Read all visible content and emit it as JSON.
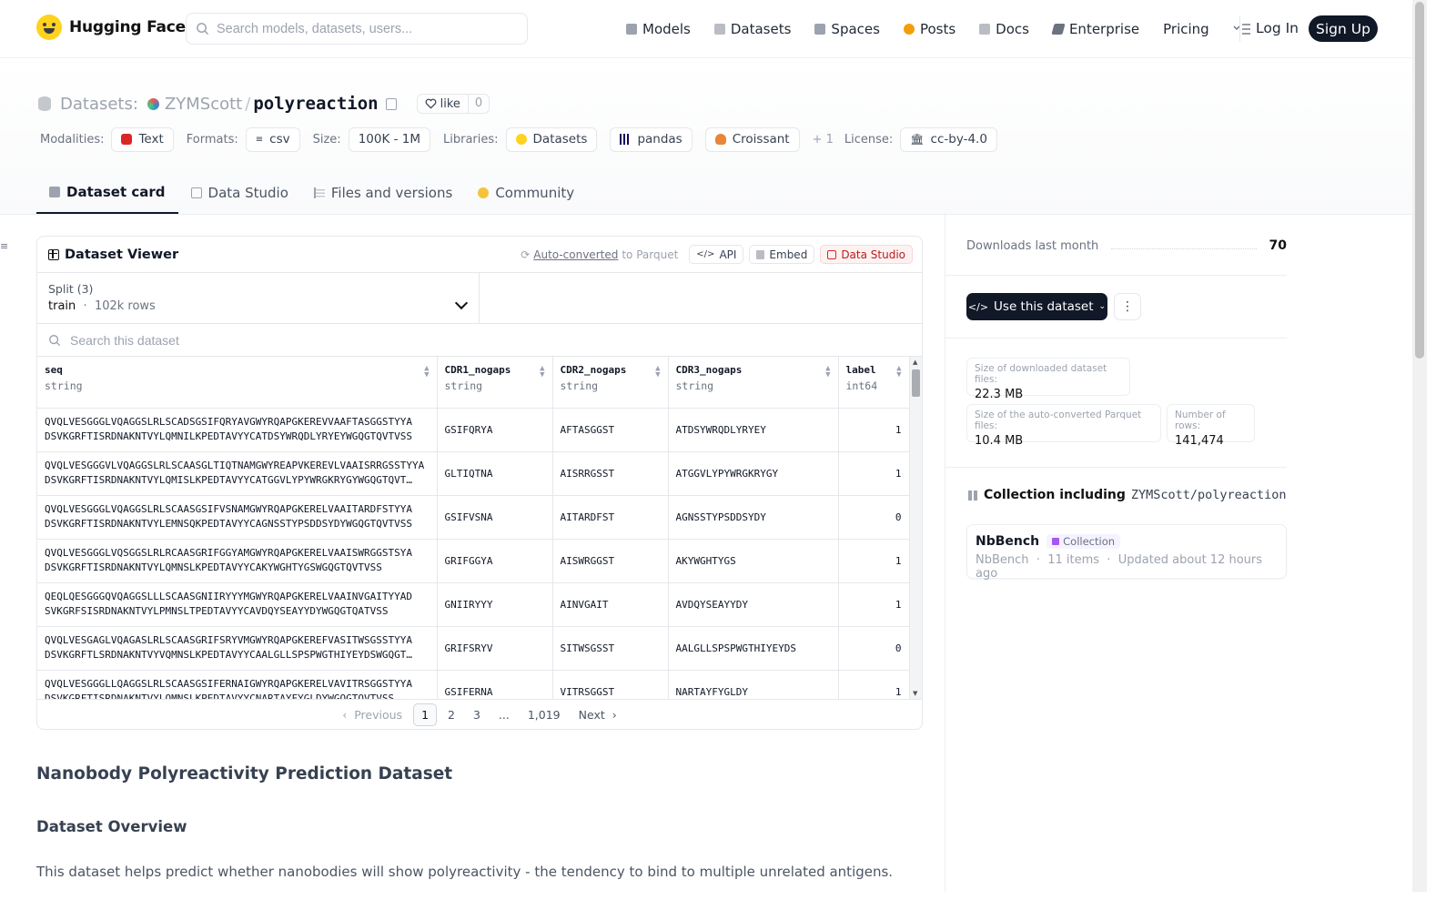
{
  "nav": {
    "brand": "Hugging Face",
    "search_placeholder": "Search models, datasets, users...",
    "links": [
      {
        "label": "Models",
        "color": "#9ca3af"
      },
      {
        "label": "Datasets",
        "color": "#b9bdc3"
      },
      {
        "label": "Spaces",
        "color": "#9ca3af"
      },
      {
        "label": "Posts",
        "color": "#f59e0b"
      },
      {
        "label": "Docs",
        "color": "#b9bdc3"
      },
      {
        "label": "Enterprise",
        "color": "#6b7280"
      },
      {
        "label": "Pricing",
        "color": ""
      }
    ],
    "login": "Log In",
    "signup": "Sign Up"
  },
  "repo": {
    "section": "Datasets:",
    "owner": "ZYMScott",
    "slash": "/",
    "name": "polyreaction",
    "like_label": "like",
    "like_count": "0"
  },
  "meta": {
    "modalities_label": "Modalities:",
    "modalities": "Text",
    "formats_label": "Formats:",
    "formats": "csv",
    "size_label": "Size:",
    "size": "100K - 1M",
    "libraries_label": "Libraries:",
    "libraries": [
      "Datasets",
      "pandas",
      "Croissant"
    ],
    "libraries_more": "+ 1",
    "license_label": "License:",
    "license": "cc-by-4.0"
  },
  "tabs": [
    "Dataset card",
    "Data Studio",
    "Files and versions",
    "Community"
  ],
  "viewer": {
    "title": "Dataset Viewer",
    "auto_converted": "Auto-converted",
    "to_parquet": "to Parquet",
    "api": "API",
    "embed": "Embed",
    "data_studio": "Data Studio",
    "split_label": "Split (3)",
    "split_name": "train",
    "split_rows": "102k rows",
    "search_placeholder": "Search this dataset",
    "columns": [
      {
        "name": "seq",
        "type": "string"
      },
      {
        "name": "CDR1_nogaps",
        "type": "string"
      },
      {
        "name": "CDR2_nogaps",
        "type": "string"
      },
      {
        "name": "CDR3_nogaps",
        "type": "string"
      },
      {
        "name": "label",
        "type": "int64"
      }
    ],
    "rows": [
      {
        "seq1": "QVQLVESGGGLVQAGGSLRLSCADSGSIFQRYAVGWYRQAPGKEREVVAAFTASGGSTYYA",
        "seq2": "DSVKGRFTISRDNAKNTVYLQMNILKPEDTAVYYCATDSYWRQDLYRYEYWGQGTQVTVSS",
        "cdr1": "GSIFQRYA",
        "cdr2": "AFTASGGST",
        "cdr3": "ATDSYWRQDLYRYEY",
        "label": "1"
      },
      {
        "seq1": "QVQLVESGGGVLVQAGGSLRLSCAASGLTIQTNAMGWYREAPVKEREVLVAAISRRGSSTYYA",
        "seq2": "DSVKGRFTISRDNAKNTVYLQMISLKPEDTAVYYCATGGVLYPYWRGKRYGYWGQGTQVT…",
        "cdr1": "GLTIQTNA",
        "cdr2": "AISRRGSST",
        "cdr3": "ATGGVLYPYWRGKRYGY",
        "label": "1"
      },
      {
        "seq1": "QVQLVESGGGLVQAGGSLRLSCAASGSIFVSNAMGWYRQAPGKERELVAAITARDFSTYYA",
        "seq2": "DSVKGRFTISRDNAKNTVYLEMNSQKPEDTAVYYCAGNSSTYPSDDSYDYWGQGTQVTVSS",
        "cdr1": "GSIFVSNA",
        "cdr2": "AITARDFST",
        "cdr3": "AGNSSTYPSDDSYDY",
        "label": "0"
      },
      {
        "seq1": "QVQLVESGGGLVQSGGSLRLRCAASGRIFGGYAMGWYRQAPGKERELVAAISWRGGSTSYA",
        "seq2": "DSVKGRFTISRDNAKNTVYLQMNSLKPEDTAVYYCAKYWGHTYGSWGQGTQVTVSS",
        "cdr1": "GRIFGGYA",
        "cdr2": "AISWRGGST",
        "cdr3": "AKYWGHTYGS",
        "label": "1"
      },
      {
        "seq1": "QEQLQESGGGQVQAGGSLLLSCAASGNIIRYYYMGWYRQAPGKERELVAAINVGAITYYAD",
        "seq2": "SVKGRFSISRDNAKNTVYLPMNSLTPEDTAVYYCAVDQYSEAYYDYWGQGTQATVSS",
        "cdr1": "GNIIRYYY",
        "cdr2": "AINVGAIT",
        "cdr3": "AVDQYSEAYYDY",
        "label": "1"
      },
      {
        "seq1": "QVQLVESGAGLVQAGASLRLSCAASGRIFSRYVMGWYRQAPGKEREFVASITWSGSSTYYA",
        "seq2": "DSVKGRFTLSRDNAKNTVYVQMNSLKPEDTAVYYCAALGLLSPSPWGTHIYEYDSWGQGT…",
        "cdr1": "GRIFSRYV",
        "cdr2": "SITWSGSST",
        "cdr3": "AALGLLSPSPWGTHIYEYDS",
        "label": "0"
      },
      {
        "seq1": "QVQLVESGGGLLQAGGSLRLSCAASGSIFERNAIGWYRQAPGKERELVAVITRSGGSTYYA",
        "seq2": "DSVKGRFTISRDNAKNTVYLQMNSLKPEDTAVYYCNARTAYFYGLDYWGQGTQVTVSS",
        "cdr1": "GSIFERNA",
        "cdr2": "VITRSGGST",
        "cdr3": "NARTAYFYGLDY",
        "label": "1"
      }
    ],
    "pager": {
      "previous": "Previous",
      "pages": [
        "1",
        "2",
        "3",
        "...",
        "1,019"
      ],
      "next": "Next"
    }
  },
  "card": {
    "h1": "Nanobody Polyreactivity Prediction Dataset",
    "h2": "Dataset Overview",
    "p": "This dataset helps predict whether nanobodies will show polyreactivity - the tendency to bind to multiple unrelated antigens."
  },
  "side": {
    "downloads_label": "Downloads last month",
    "downloads_value": "70",
    "use_button": "Use this dataset",
    "size_dl_label": "Size of downloaded dataset files:",
    "size_dl_value": "22.3 MB",
    "size_parquet_label": "Size of the auto-converted Parquet files:",
    "size_parquet_value": "10.4 MB",
    "rows_label": "Number of rows:",
    "rows_value": "141,474",
    "collection_prefix": "Collection including",
    "collection_repo": "ZYMScott/polyreaction",
    "collection_name": "NbBench",
    "collection_badge": "Collection",
    "collection_owner": "NbBench",
    "collection_items": "11 items",
    "collection_updated": "Updated about 12 hours ago"
  }
}
